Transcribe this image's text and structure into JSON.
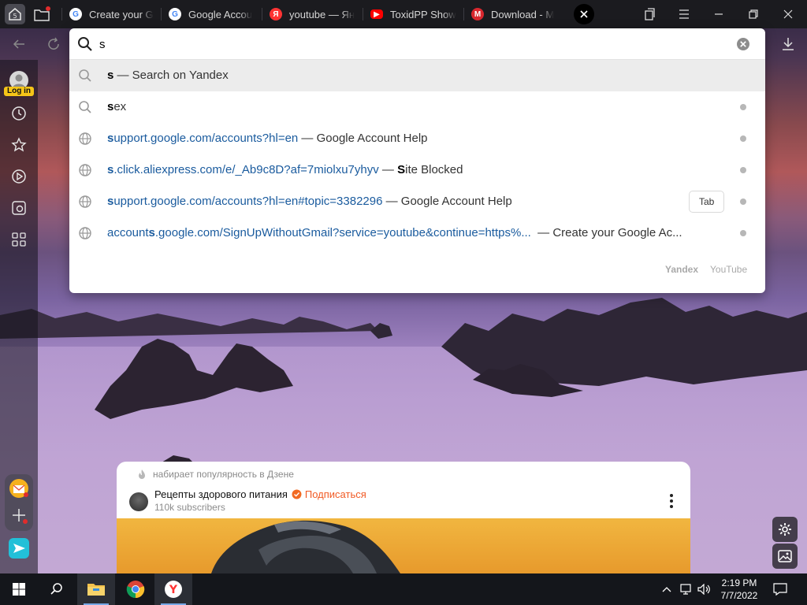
{
  "tabs": [
    {
      "label": "Create your G",
      "favicon": "google-icon"
    },
    {
      "label": "Google Accou",
      "favicon": "google-icon"
    },
    {
      "label": "youtube — Ян",
      "favicon": "yandex-icon"
    },
    {
      "label": "ToxidPP Show",
      "favicon": "youtube-icon"
    },
    {
      "label": "Download - M",
      "favicon": "mega-icon"
    }
  ],
  "address_bar": {
    "value": "s"
  },
  "sidebar": {
    "login_label": "Log in"
  },
  "suggestions": [
    {
      "bold": "s",
      "rest": " — Search on Yandex",
      "icon": "search-icon",
      "active": true
    },
    {
      "bold": "s",
      "rest": "ex",
      "icon": "search-icon"
    },
    {
      "url_bold": "s",
      "url_rest": "upport.google.com/accounts?hl=en",
      "title": " — Google Account Help",
      "icon": "globe-icon"
    },
    {
      "url_bold": "s",
      "url_rest": ".click.aliexpress.com/e/_Ab9c8D?af=7miolxu7yhyv",
      "title_pre": " — ",
      "title_bold": "S",
      "title": "ite Blocked",
      "icon": "globe-icon"
    },
    {
      "url_bold": "s",
      "url_rest": "upport.google.com/accounts?hl=en#topic=3382296",
      "title": " — Google Account Help",
      "icon": "globe-icon",
      "tab_hint": "Tab"
    },
    {
      "url_pre": "account",
      "url_bold": "s",
      "url_rest": ".google.com/SignUpWithoutGmail?service=youtube&continue=https%...",
      "title": "  — Create your Google Ac...",
      "icon": "globe-icon"
    }
  ],
  "search_engines": [
    "Yandex",
    "YouTube"
  ],
  "zen_card": {
    "trending": "набирает популярность в Дзене",
    "channel": "Рецепты здорового питания",
    "subscribe": "Подписаться",
    "subscribers": "110k subscribers"
  },
  "taskbar": {
    "time": "2:19 PM",
    "date": "7/7/2022"
  },
  "colors": {
    "accent_orange": "#f15a24",
    "url_blue": "#1a5b9e",
    "verified": "#f26a22"
  }
}
